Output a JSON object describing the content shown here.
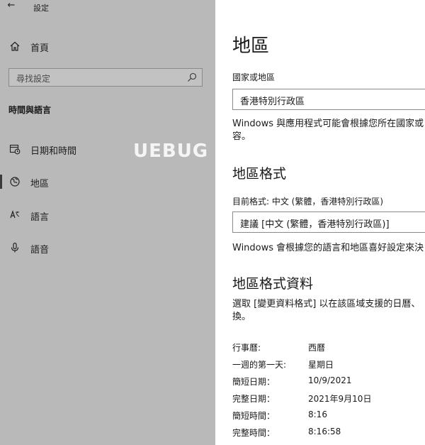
{
  "window": {
    "title": "設定",
    "back_label": "←"
  },
  "sidebar": {
    "home_label": "首頁",
    "search_placeholder": "尋找設定",
    "section_title": "時間與語言",
    "items": [
      {
        "label": "日期和時間",
        "icon": "calendar-clock-icon",
        "selected": false
      },
      {
        "label": "地區",
        "icon": "globe-icon",
        "selected": true
      },
      {
        "label": "語言",
        "icon": "language-icon",
        "selected": false
      },
      {
        "label": "語音",
        "icon": "microphone-icon",
        "selected": false
      }
    ]
  },
  "watermark": "UEBUG",
  "main": {
    "title": "地區",
    "country_label": "國家或地區",
    "country_value": "香港特別行政區",
    "country_desc_line1": "Windows 與應用程式可能會根據您所在國家或",
    "country_desc_line2": "容。",
    "format_title": "地區格式",
    "current_format_label": "目前格式: 中文 (繁體，香港特別行政區)",
    "format_value": "建議 [中文 (繁體，香港特別行政區)]",
    "format_desc": "Windows 會根據您的語言和地區喜好設定來決",
    "data_title": "地區格式資料",
    "data_desc_line1": "選取 [變更資料格式] 以在該區域支援的日曆、",
    "data_desc_line2": "換。",
    "rows": [
      {
        "key": "行事曆:",
        "value": "西曆"
      },
      {
        "key": "一週的第一天:",
        "value": "星期日"
      },
      {
        "key": "簡短日期：",
        "value": "10/9/2021"
      },
      {
        "key": "完整日期：",
        "value": "2021年9月10日"
      },
      {
        "key": "簡短時間：",
        "value": "8:16"
      },
      {
        "key": "完整時間：",
        "value": "8:16:58"
      }
    ]
  }
}
